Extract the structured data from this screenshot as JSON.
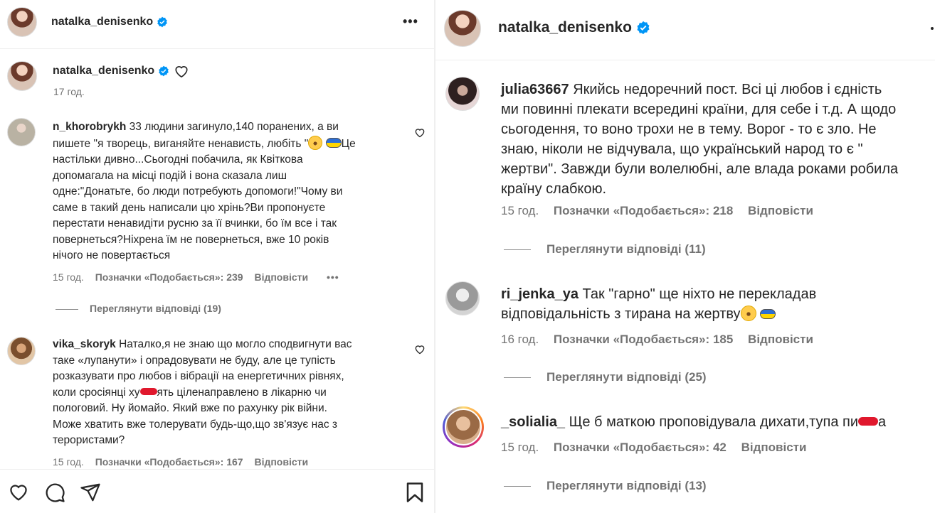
{
  "left": {
    "header": {
      "username": "natalka_denisenko",
      "more_label": "•••"
    },
    "caption": {
      "username": "natalka_denisenko",
      "time": "17 год."
    },
    "comments": [
      {
        "username": "n_khorobrykh",
        "text_lines": [
          "33 людини загинуло,140 поранених, а ви",
          "пишете \"я творець, виганяйте ненависть, любіть \"",
          "настільки дивно...Сьогодні побачила, як Квіткова",
          "допомагала на місці подій і вона сказала лиш",
          "одне:\"Донатьте, бо люди потребують допомоги!\"Чому ви",
          "саме в такий день написали цю хрінь?Ви пропонуєте",
          "перестати ненавидіти русню за її вчинки, бо їм все і так",
          "повернеться?Ніхрена їм не повернеться, вже 10 років",
          "нічого не повертається"
        ],
        "line2_suffix": "Це",
        "time": "15 год.",
        "likes": "Позначки «Подобається»: 239",
        "reply": "Відповісти",
        "more": "•••",
        "view_replies": "Переглянути відповіді (19)"
      },
      {
        "username": "vika_skoryk",
        "text_lines": [
          "Наталко,я не знаю що могло сподвигнути вас",
          "таке «лупанути» і опрадовувати не буду, але це тупість",
          "розказувати про любов і вібрації на енергетичних рівнях,",
          "коли сросіянці ху",
          "ять цiленаправлено в лікарню чи",
          "пологовий. Ну йомайо. Який вже по рахунку рік війни.",
          "Може хватить вже толерувати будь-що,що зв'язує нас з",
          "терористами?"
        ],
        "time": "15 год.",
        "likes": "Позначки «Подобається»: 167",
        "reply": "Відповісти"
      }
    ]
  },
  "right": {
    "header": {
      "username": "natalka_denisenko"
    },
    "comments": [
      {
        "username": "julia63667",
        "text_lines": [
          "Якийсь недоречний пост. Всі ці любов і єдність",
          "ми повинні плекати всередині країни, для себе і т.д. А щодо",
          "сьогодення, то воно трохи не в тему. Ворог - то є зло. Не",
          "знаю, ніколи не відчувала, що український народ то є \"",
          "жертви\". Завжди були волелюбні, але влада роками робила",
          "країну слабкою."
        ],
        "time": "15 год.",
        "likes": "Позначки «Подобається»: 218",
        "reply": "Відповісти",
        "view_replies": "Переглянути відповіді (11)"
      },
      {
        "username": "ri_jenka_ya",
        "text_lines": [
          "Так \"гарно\" ще ніхто не перекладав",
          "відповідальність з тирана на жертву"
        ],
        "time": "16 год.",
        "likes": "Позначки «Подобається»: 185",
        "reply": "Відповісти",
        "view_replies": "Переглянути відповіді (25)"
      },
      {
        "username": "_solialia_",
        "text_lines": [
          "Ще б маткою проповідувала дихати,тупа пи",
          "а"
        ],
        "time": "15 год.",
        "likes": "Позначки «Подобається»: 42",
        "reply": "Відповісти",
        "view_replies": "Переглянути відповіді (13)"
      }
    ]
  },
  "colors": {
    "verified": "#0095f6",
    "text": "#262626",
    "meta": "#737373",
    "censor": "#e0182d"
  }
}
